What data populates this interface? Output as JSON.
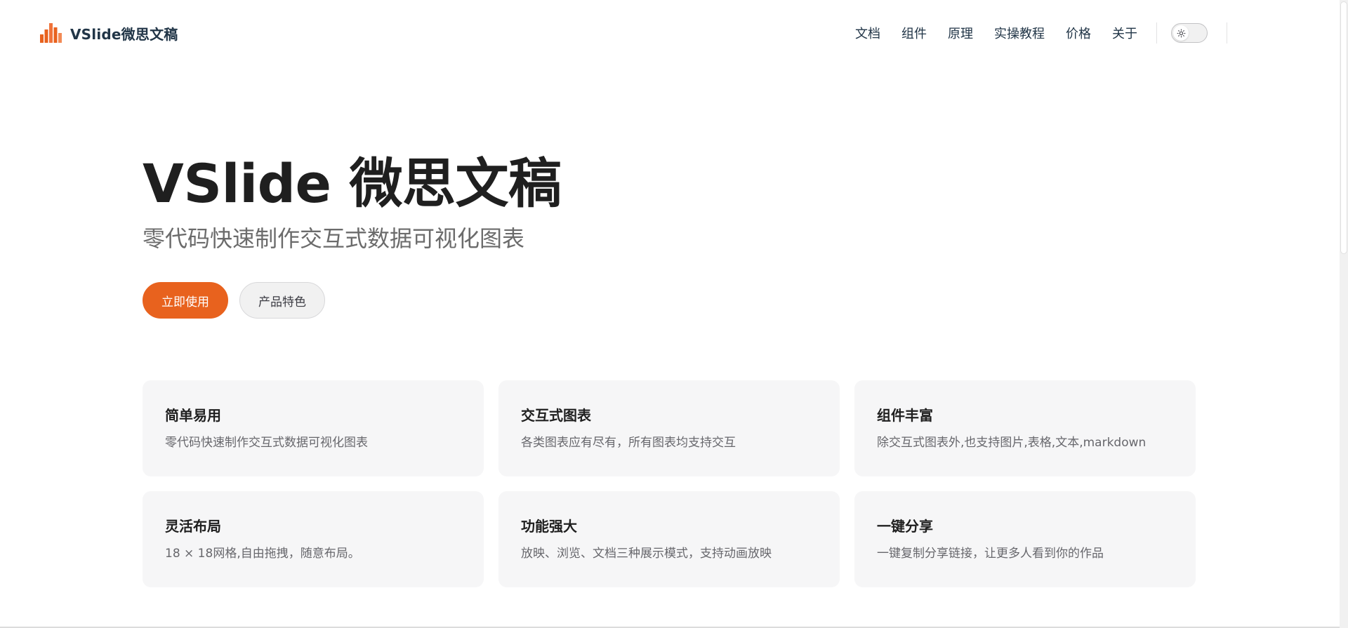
{
  "header": {
    "brand_title": "VSlide微思文稿",
    "nav": [
      {
        "label": "文档"
      },
      {
        "label": "组件"
      },
      {
        "label": "原理"
      },
      {
        "label": "实操教程"
      },
      {
        "label": "价格"
      },
      {
        "label": "关于"
      }
    ],
    "theme_icon": "sun-icon"
  },
  "hero": {
    "title": "VSlide 微思文稿",
    "tagline": "零代码快速制作交互式数据可视化图表",
    "primary_button": "立即使用",
    "secondary_button": "产品特色"
  },
  "features": [
    {
      "title": "简单易用",
      "desc": "零代码快速制作交互式数据可视化图表"
    },
    {
      "title": "交互式图表",
      "desc": "各类图表应有尽有，所有图表均支持交互"
    },
    {
      "title": "组件丰富",
      "desc": "除交互式图表外,也支持图片,表格,文本,markdown"
    },
    {
      "title": "灵活布局",
      "desc": "18 × 18网格,自由拖拽，随意布局。"
    },
    {
      "title": "功能强大",
      "desc": "放映、浏览、文档三种展示模式，支持动画放映"
    },
    {
      "title": "一键分享",
      "desc": "一键复制分享链接，让更多人看到你的作品"
    }
  ],
  "colors": {
    "accent": "#e8621e",
    "logo_bars": "#e8621e",
    "feature_bg": "#f6f6f7"
  }
}
